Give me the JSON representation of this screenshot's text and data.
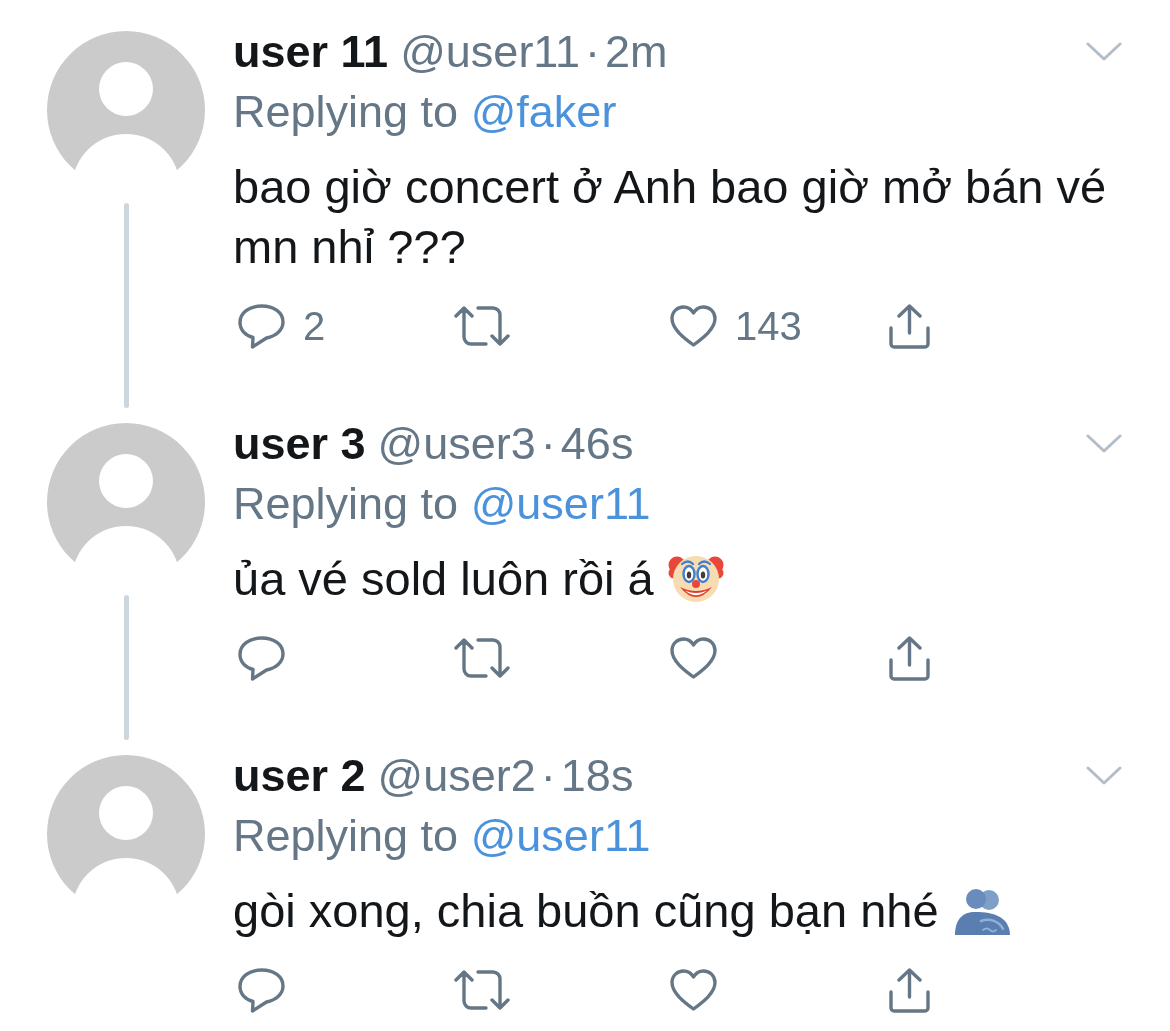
{
  "tweets": [
    {
      "display_name": "user 11",
      "handle": "@user11",
      "separator": "·",
      "time": "2m",
      "replying_label": "Replying to",
      "replying_to": "@faker",
      "text": "bao giờ concert ở Anh bao giờ mở bán vé mn nhỉ ???",
      "thread_continues": true,
      "actions": [
        {
          "kind": "reply",
          "count": "2"
        },
        {
          "kind": "retweet"
        },
        {
          "kind": "like",
          "count": "143"
        },
        {
          "kind": "share"
        }
      ]
    },
    {
      "display_name": "user 3",
      "handle": "@user3",
      "separator": "·",
      "time": "46s",
      "replying_label": "Replying to",
      "replying_to": "@user11",
      "text": "ủa vé sold luôn rồi á",
      "emoji": {
        "kind": "clown"
      },
      "thread_continues": true,
      "actions": [
        {
          "kind": "reply"
        },
        {
          "kind": "retweet"
        },
        {
          "kind": "like"
        },
        {
          "kind": "share"
        }
      ]
    },
    {
      "display_name": "user 2",
      "handle": "@user2",
      "separator": "·",
      "time": "18s",
      "replying_label": "Replying to",
      "replying_to": "@user11",
      "text": "gòi xong, chia buồn cũng bạn nhé",
      "emoji": {
        "kind": "hug"
      },
      "thread_continues": false,
      "actions": [
        {
          "kind": "reply"
        },
        {
          "kind": "retweet"
        },
        {
          "kind": "like"
        },
        {
          "kind": "share"
        }
      ]
    }
  ]
}
